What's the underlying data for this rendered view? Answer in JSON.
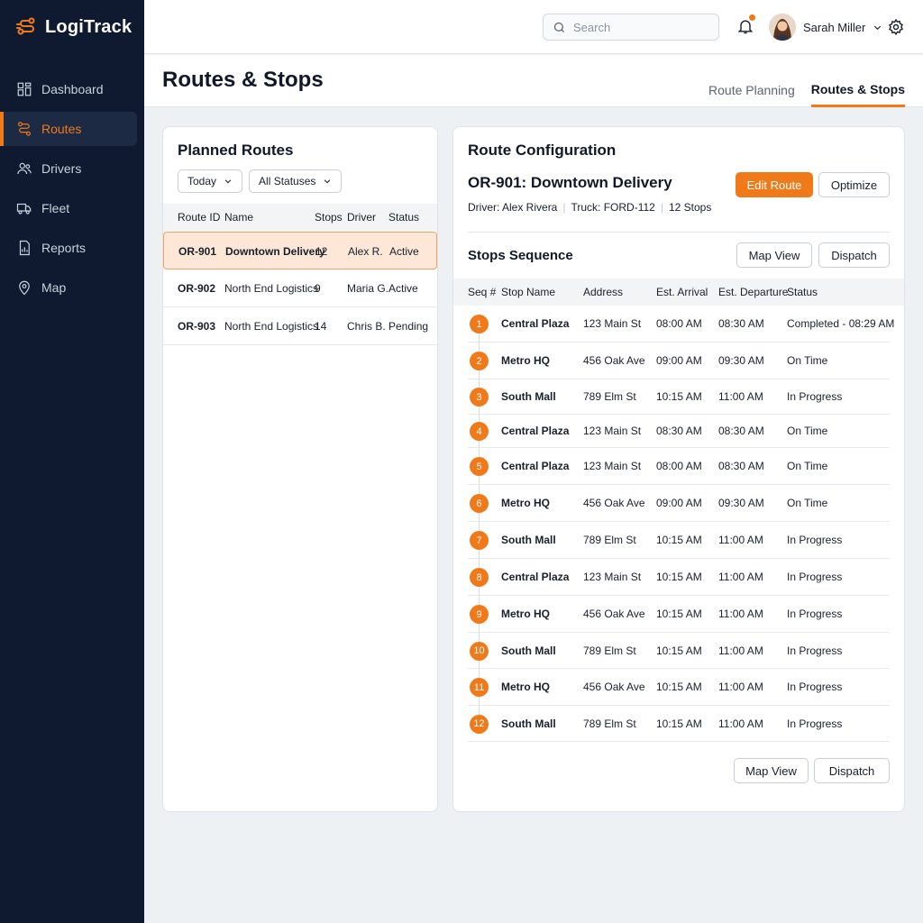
{
  "app": {
    "name": "LogiTrack"
  },
  "sidebar": {
    "items": [
      {
        "label": "Dashboard",
        "icon": "grid-icon",
        "active": false
      },
      {
        "label": "Routes",
        "icon": "route-icon",
        "active": true
      },
      {
        "label": "Drivers",
        "icon": "users-icon",
        "active": false
      },
      {
        "label": "Fleet",
        "icon": "truck-icon",
        "active": false
      },
      {
        "label": "Reports",
        "icon": "report-icon",
        "active": false
      },
      {
        "label": "Map",
        "icon": "map-pin-icon",
        "active": false
      }
    ]
  },
  "header": {
    "search_placeholder": "Search",
    "user_name": "Sarah Miller",
    "accent_color": "#f07a1a"
  },
  "page": {
    "title": "Routes & Stops",
    "tabs": [
      {
        "label": "Route Planning",
        "active": false
      },
      {
        "label": "Routes & Stops",
        "active": true
      }
    ]
  },
  "planned_routes": {
    "title": "Planned Routes",
    "filters": {
      "date": "Today",
      "status": "All Statuses"
    },
    "columns": {
      "id": "Route ID",
      "name": "Name",
      "stops": "Stops",
      "driver": "Driver",
      "status": "Status"
    },
    "rows": [
      {
        "id": "OR-901",
        "name": "Downtown Delivery",
        "stops": "12",
        "driver": "Alex R.",
        "status": "Active",
        "selected": true
      },
      {
        "id": "OR-902",
        "name": "North End Logistics",
        "stops": "9",
        "driver": "Maria G.",
        "status": "Active",
        "selected": false
      },
      {
        "id": "OR-903",
        "name": "North End Logistics",
        "stops": "14",
        "driver": "Chris B.",
        "status": "Pending",
        "selected": false
      }
    ]
  },
  "route_config": {
    "title": "Route Configuration",
    "route_name": "OR-901: Downtown Delivery",
    "driver": "Driver: Alex Rivera",
    "truck": "Truck: FORD-112",
    "stops_count": "12 Stops",
    "edit_label": "Edit Route",
    "optimize_label": "Optimize",
    "stops_title": "Stops Sequence",
    "map_view_label": "Map View",
    "dispatch_label": "Dispatch",
    "columns": {
      "seq": "Seq #",
      "name": "Stop Name",
      "address": "Address",
      "arrival": "Est. Arrival",
      "departure": "Est. Departure",
      "status": "Status"
    },
    "stops": [
      {
        "seq": "1",
        "name": "Central Plaza",
        "address": "123 Main St",
        "arrival": "08:00 AM",
        "departure": "08:30 AM",
        "status": "Completed - 08:29 AM"
      },
      {
        "seq": "2",
        "name": "Metro HQ",
        "address": "456 Oak Ave",
        "arrival": "09:00 AM",
        "departure": "09:30 AM",
        "status": "On Time"
      },
      {
        "seq": "3",
        "name": "South Mall",
        "address": "789 Elm St",
        "arrival": "10:15 AM",
        "departure": "11:00 AM",
        "status": "In Progress"
      },
      {
        "seq": "4",
        "name": "Central Plaza",
        "address": "123 Main St",
        "arrival": "08:30 AM",
        "departure": "08:30 AM",
        "status": "On Time"
      },
      {
        "seq": "5",
        "name": "Central Plaza",
        "address": "123 Main St",
        "arrival": "08:00 AM",
        "departure": "08:30 AM",
        "status": "On Time"
      },
      {
        "seq": "6",
        "name": "Metro HQ",
        "address": "456 Oak Ave",
        "arrival": "09:00 AM",
        "departure": "09:30 AM",
        "status": "On Time"
      },
      {
        "seq": "7",
        "name": "South Mall",
        "address": "789 Elm St",
        "arrival": "10:15 AM",
        "departure": "11:00 AM",
        "status": "In Progress"
      },
      {
        "seq": "8",
        "name": "Central Plaza",
        "address": "123 Main St",
        "arrival": "10:15 AM",
        "departure": "11:00 AM",
        "status": "In Progress"
      },
      {
        "seq": "9",
        "name": "Metro HQ",
        "address": "456 Oak Ave",
        "arrival": "10:15 AM",
        "departure": "11:00 AM",
        "status": "In Progress"
      },
      {
        "seq": "10",
        "name": "South Mall",
        "address": "789 Elm St",
        "arrival": "10:15 AM",
        "departure": "11:00 AM",
        "status": "In Progress"
      },
      {
        "seq": "11",
        "name": "Metro HQ",
        "address": "456 Oak Ave",
        "arrival": "10:15 AM",
        "departure": "11:00 AM",
        "status": "In Progress"
      },
      {
        "seq": "12",
        "name": "South Mall",
        "address": "789 Elm St",
        "arrival": "10:15 AM",
        "departure": "11:00 AM",
        "status": "In Progress"
      }
    ]
  }
}
